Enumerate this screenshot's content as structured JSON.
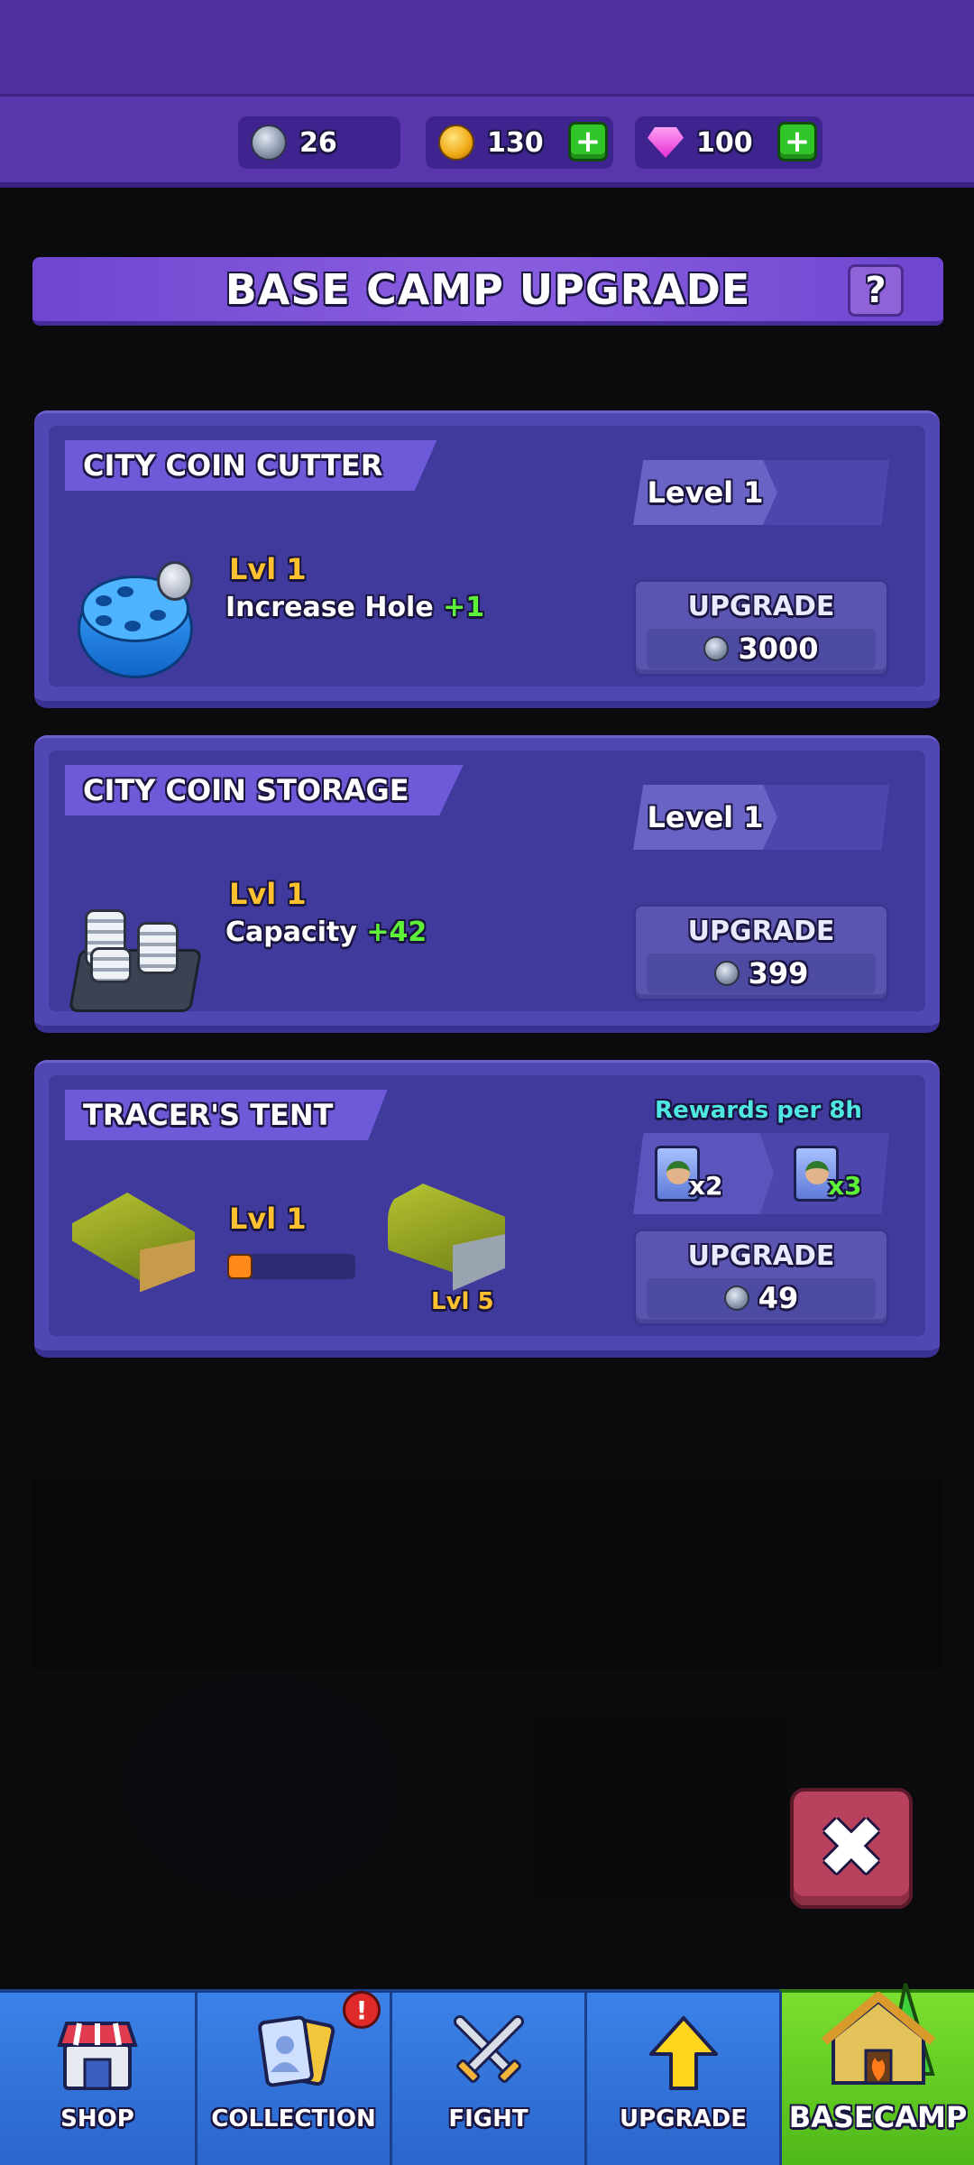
{
  "currencies": {
    "silver": "26",
    "gold": "130",
    "gems": "100"
  },
  "header": {
    "title": "BASE CAMP UPGRADE",
    "help": "?"
  },
  "cards": [
    {
      "title": "CITY COIN CUTTER",
      "level_plate": "Level 1",
      "lvl": "Lvl 1",
      "desc_label": "Increase Hole",
      "desc_bonus": "+1",
      "upgrade_label": "UPGRADE",
      "upgrade_cost": "3000"
    },
    {
      "title": "CITY COIN STORAGE",
      "level_plate": "Level 1",
      "lvl": "Lvl 1",
      "desc_label": "Capacity",
      "desc_bonus": "+42",
      "upgrade_label": "UPGRADE",
      "upgrade_cost": "399"
    },
    {
      "title": "TRACER'S TENT",
      "rewards_label": "Rewards per 8h",
      "reward_a": "x2",
      "reward_b": "x3",
      "lvl": "Lvl 1",
      "next_lvl": "Lvl 5",
      "progress": 0.2,
      "upgrade_label": "UPGRADE",
      "upgrade_cost": "49"
    }
  ],
  "close": "✖",
  "nav": {
    "shop": "SHOP",
    "collection": "COLLECTION",
    "collection_badge": "!",
    "fight": "FIGHT",
    "upgrade": "UPGRADE",
    "basecamp": "BASECAMP"
  },
  "colors": {
    "accent_purple": "#5a36ad",
    "card_bg": "#5047b4",
    "lvl_yellow": "#ffc12e",
    "bonus_green": "#5df238",
    "nav_blue": "#3b82e8",
    "nav_active_green": "#7adf2e"
  }
}
